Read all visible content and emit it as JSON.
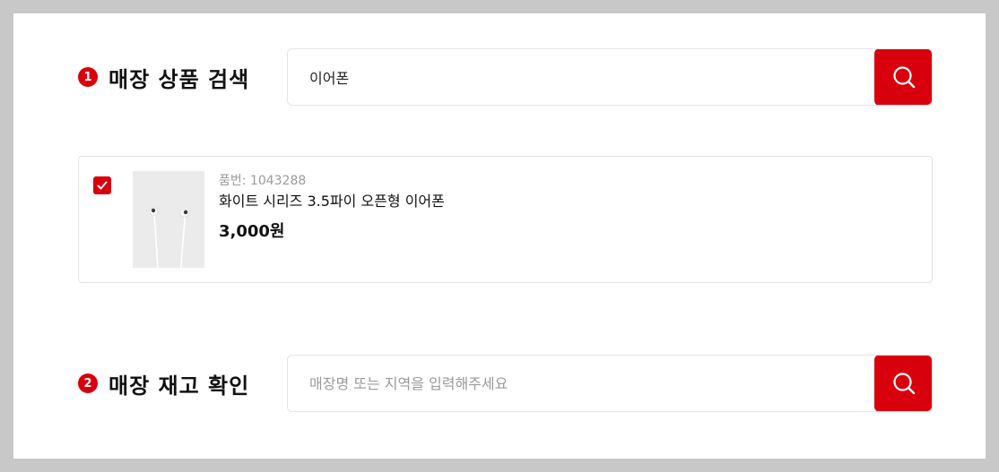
{
  "product_search": {
    "step": "1",
    "title": "매장 상품 검색",
    "query": "이어폰",
    "button_icon": "search-icon"
  },
  "result": {
    "checked": true,
    "code": "품번: 1043288",
    "name": "화이트 시리즈 3.5파이 오픈형 이어폰",
    "price": "3,000원"
  },
  "stock_check": {
    "step": "2",
    "title": "매장 재고 확인",
    "placeholder": "매장명 또는 지역을 입력해주세요",
    "button_icon": "search-icon"
  },
  "colors": {
    "accent": "#d9000d",
    "border": "#e4e4e4",
    "backdrop": "#c8c8c8"
  }
}
